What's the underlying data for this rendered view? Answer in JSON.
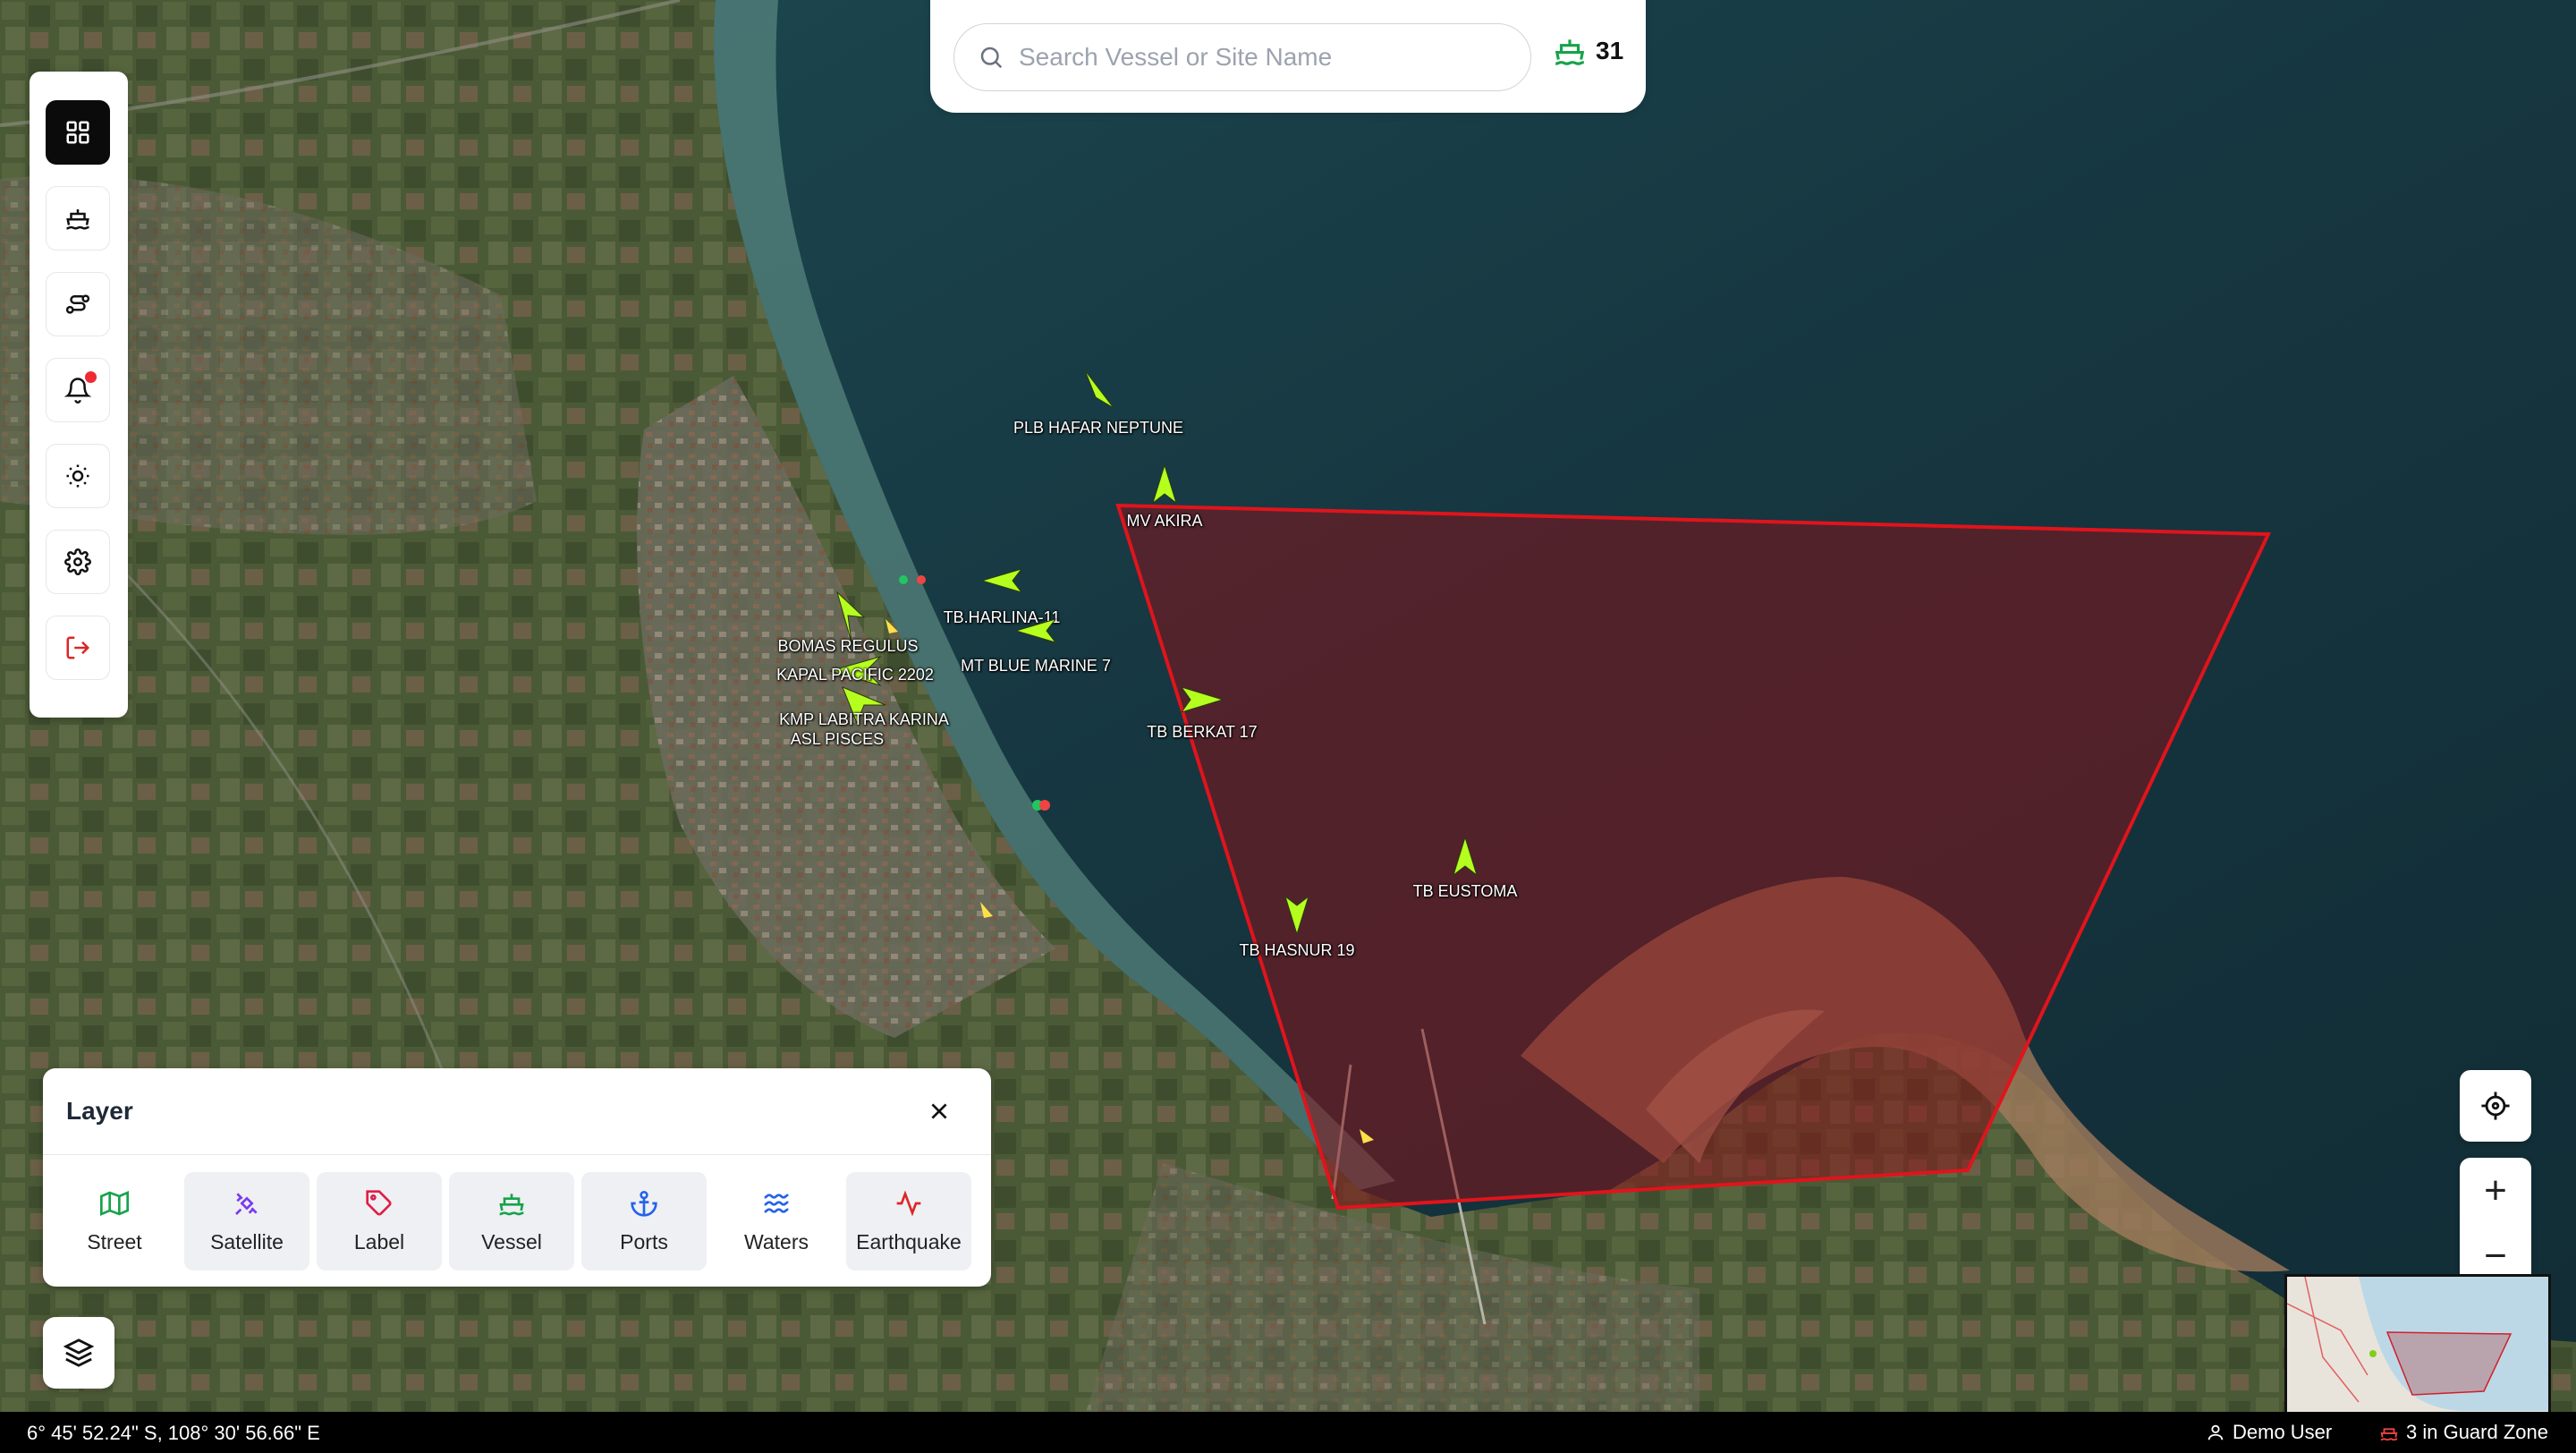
{
  "search": {
    "placeholder": "Search Vessel or Site Name",
    "vessel_count": "31"
  },
  "toolbar": {
    "items": [
      "dashboard",
      "vessel",
      "route",
      "notifications",
      "brightness",
      "settings",
      "logout"
    ],
    "active": "dashboard",
    "notification_dot": true
  },
  "map": {
    "guard_zone_color": "#e0141c",
    "vessel_marker_color": "#b5ff1f",
    "vessels": [
      {
        "name": "PLB HAFAR NEPTUNE"
      },
      {
        "name": "MV AKIRA"
      },
      {
        "name": "TB.HARLINA-11"
      },
      {
        "name": "MT BLUE MARINE 7"
      },
      {
        "name": "BOMAS REGULUS"
      },
      {
        "name": "KAPAL PACIFIC 2202"
      },
      {
        "name": "KMP LABITRA KARINA"
      },
      {
        "name": "ASL PISCES"
      },
      {
        "name": "TB BERKAT 17"
      },
      {
        "name": "TB EUSTOMA"
      },
      {
        "name": "TB HASNUR 19"
      }
    ]
  },
  "layer_panel": {
    "title": "Layer",
    "options": [
      {
        "label": "Street",
        "icon": "map-icon",
        "color": "#16a34a",
        "selected": false
      },
      {
        "label": "Satellite",
        "icon": "satellite-icon",
        "color": "#7c3aed",
        "selected": true
      },
      {
        "label": "Label",
        "icon": "tag-icon",
        "color": "#e11d48",
        "selected": true
      },
      {
        "label": "Vessel",
        "icon": "ship-icon",
        "color": "#16a34a",
        "selected": true
      },
      {
        "label": "Ports",
        "icon": "anchor-icon",
        "color": "#2563eb",
        "selected": true
      },
      {
        "label": "Waters",
        "icon": "waves-icon",
        "color": "#2563eb",
        "selected": false
      },
      {
        "label": "Earthquake",
        "icon": "activity-icon",
        "color": "#dc2626",
        "selected": true
      }
    ]
  },
  "status_bar": {
    "coordinates": "6° 45' 52.24\" S, 108° 30' 56.66\" E",
    "user": "Demo User",
    "guard_zone": "3 in Guard Zone"
  }
}
